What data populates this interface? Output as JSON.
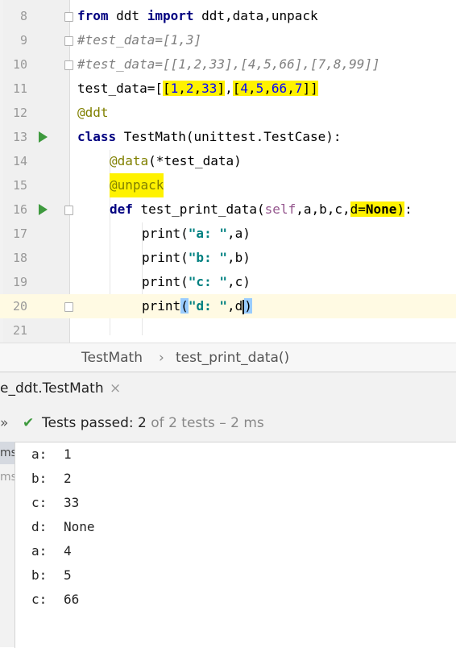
{
  "editor": {
    "lines": [
      {
        "num": "8",
        "code": "from ddt import ddt,data,unpack"
      },
      {
        "num": "9",
        "code": "#test_data=[1,3]"
      },
      {
        "num": "10",
        "code": "#test_data=[[1,2,33],[4,5,66],[7,8,99]]"
      },
      {
        "num": "11",
        "code": "test_data=[[1,2,33],[4,5,66,7]]"
      },
      {
        "num": "12",
        "code": "@ddt"
      },
      {
        "num": "13",
        "code": "class TestMath(unittest.TestCase):"
      },
      {
        "num": "14",
        "code": "@data(*test_data)"
      },
      {
        "num": "15",
        "code": "@unpack"
      },
      {
        "num": "16",
        "code": "def test_print_data(self,a,b,c,d=None):"
      },
      {
        "num": "17",
        "code": "print(\"a: \",a)"
      },
      {
        "num": "18",
        "code": "print(\"b: \",b)"
      },
      {
        "num": "19",
        "code": "print(\"c: \",c)"
      },
      {
        "num": "20",
        "code": "print(\"d: \",d)"
      },
      {
        "num": "21",
        "code": ""
      }
    ]
  },
  "breadcrumb": {
    "class_name": "TestMath",
    "separator": "›",
    "method_name": "test_print_data()"
  },
  "run_panel": {
    "tab_label": "e_ddt.TestMath",
    "tab_close": "×",
    "status_chevron": "»",
    "status_check": "✔",
    "status_prefix": "Tests passed: ",
    "status_count": "2",
    "status_rest": " of 2 tests – 2 ms",
    "sidebar_items": [
      "ms",
      "ms"
    ],
    "output": [
      {
        "label": "a:",
        "value": "1"
      },
      {
        "label": "b:",
        "value": "2"
      },
      {
        "label": "c:",
        "value": "33"
      },
      {
        "label": "d:",
        "value": "None"
      },
      {
        "label": "a:",
        "value": "4"
      },
      {
        "label": "b:",
        "value": "5"
      },
      {
        "label": "c:",
        "value": "66"
      }
    ]
  },
  "colors": {
    "highlight": "#fff200",
    "brace_match": "#99ccff",
    "run_icon": "#3e9a3e",
    "keyword": "#000080",
    "decorator": "#808000",
    "number": "#0000ff",
    "string": "#008080",
    "comment": "#808080",
    "self": "#94558d"
  }
}
